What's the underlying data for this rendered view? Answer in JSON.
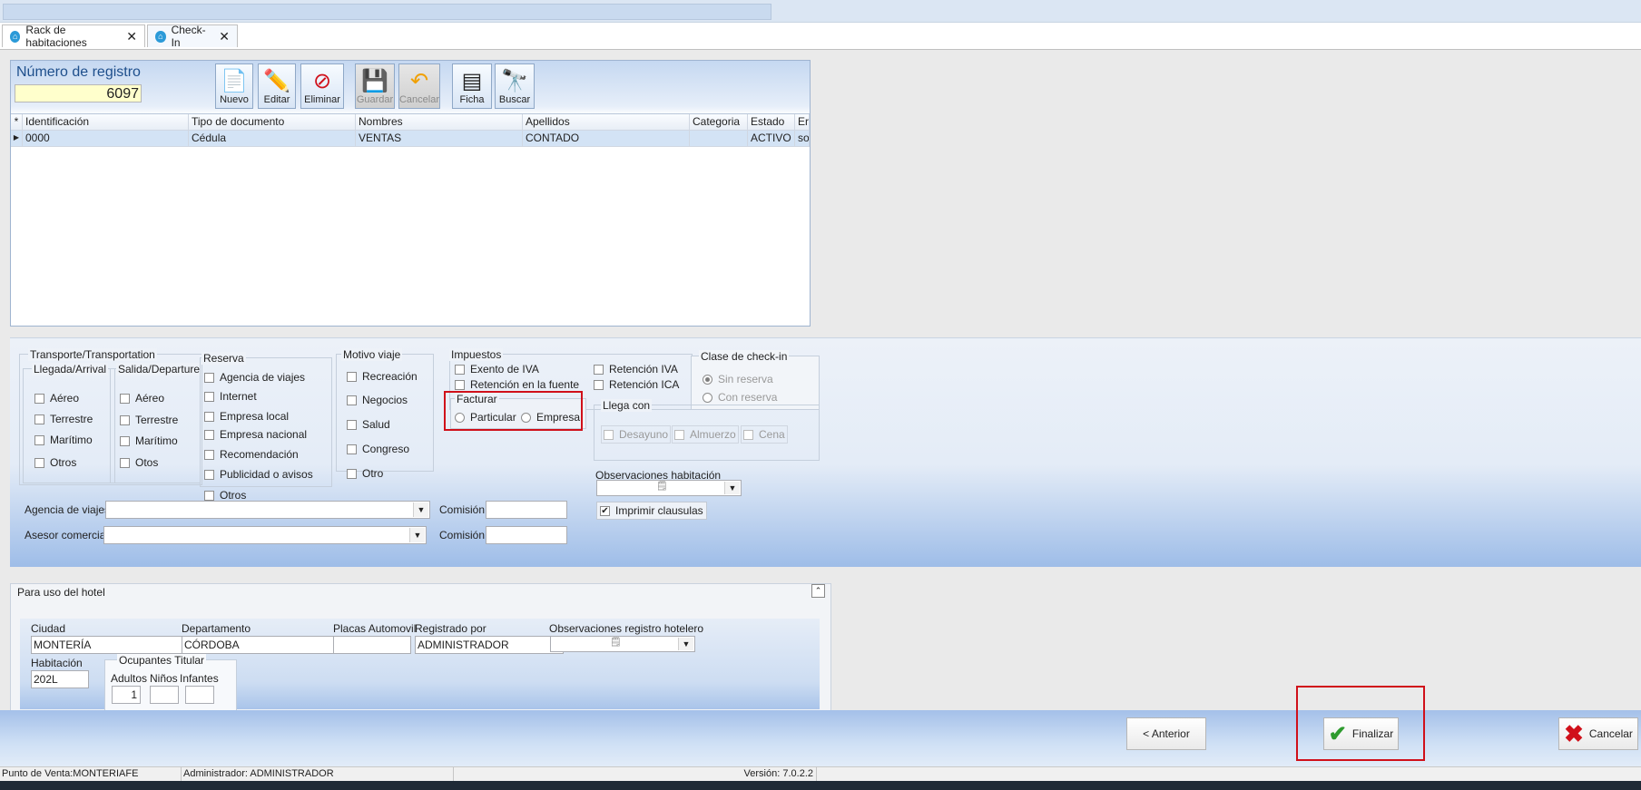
{
  "tabs": [
    {
      "label": "Rack de habitaciones",
      "icon": "hotel-icon"
    },
    {
      "label": "Check-In",
      "icon": "hotel-icon"
    }
  ],
  "registro": {
    "label": "Número de registro",
    "value": "6097"
  },
  "toolbar": {
    "nuevo": "Nuevo",
    "editar": "Editar",
    "eliminar": "Eliminar",
    "guardar": "Guardar",
    "cancelar": "Cancelar",
    "ficha": "Ficha",
    "buscar": "Buscar"
  },
  "grid": {
    "headers": [
      "Identificación",
      "Tipo de documento",
      "Nombres",
      "Apellidos",
      "Categoria",
      "Estado",
      "Er"
    ],
    "rows": [
      [
        "0000",
        "Cédula",
        "VENTAS",
        "CONTADO",
        "",
        "ACTIVO",
        "so"
      ]
    ]
  },
  "transporte": {
    "title": "Transporte/Transportation",
    "llegada": {
      "title": "Llegada/Arrival",
      "items": [
        "Aéreo",
        "Terrestre",
        "Marítimo",
        "Otros"
      ]
    },
    "salida": {
      "title": "Salida/Departure",
      "items": [
        "Aéreo",
        "Terrestre",
        "Marítimo",
        "Otos"
      ]
    }
  },
  "reserva": {
    "title": "Reserva",
    "items": [
      "Agencia de viajes",
      "Internet",
      "Empresa local",
      "Empresa nacional",
      "Recomendación",
      "Publicidad o avisos",
      "Otros"
    ]
  },
  "motivo": {
    "title": "Motivo viaje",
    "items": [
      "Recreación",
      "Negocios",
      "Salud",
      "Congreso",
      "Otro"
    ]
  },
  "impuestos": {
    "title": "Impuestos",
    "exento_iva": "Exento de IVA",
    "retencion_fuente": "Retención en la fuente",
    "retencion_iva": "Retención IVA",
    "retencion_ica": "Retención ICA"
  },
  "facturar": {
    "title": "Facturar",
    "particular": "Particular",
    "empresa": "Empresa"
  },
  "clase_checkin": {
    "title": "Clase de check-in",
    "sin_reserva": "Sin reserva",
    "con_reserva": "Con reserva"
  },
  "llega_con": {
    "title": "Llega con",
    "desayuno": "Desayuno",
    "almuerzo": "Almuerzo",
    "cena": "Cena"
  },
  "observaciones_habitacion": {
    "label": "Observaciones habitación"
  },
  "imprimir_clausulas": {
    "label": "Imprimir clausulas",
    "checked": true
  },
  "agencia": {
    "label": "Agencia de viajes",
    "comision_label": "Comisión"
  },
  "asesor": {
    "label": "Asesor comercial",
    "comision_label": "Comisión"
  },
  "hotel": {
    "title": "Para uso del hotel",
    "ciudad": {
      "label": "Ciudad",
      "value": "MONTERÍA"
    },
    "departamento": {
      "label": "Departamento",
      "value": "CÓRDOBA"
    },
    "placas": {
      "label": "Placas Automovil",
      "value": ""
    },
    "registrado": {
      "label": "Registrado por",
      "value": "ADMINISTRADOR"
    },
    "obs_registro": {
      "label": "Observaciones registro hotelero"
    },
    "habitacion": {
      "label": "Habitación",
      "value": "202L"
    },
    "ocupantes": {
      "title": "Ocupantes Titular",
      "adultos": "Adultos",
      "ninos": "Niños",
      "infantes": "Infantes",
      "adultos_value": "1"
    }
  },
  "buttons": {
    "anterior": "< Anterior",
    "finalizar": "Finalizar",
    "cancelar": "Cancelar"
  },
  "status": {
    "punto_venta": "Punto de Venta:MONTERIAFE",
    "administrador": "Administrador: ADMINISTRADOR",
    "version": "Versión: 7.0.2.2"
  },
  "colors": {
    "highlight": "#d0101a",
    "accent": "#2b9ad8"
  }
}
